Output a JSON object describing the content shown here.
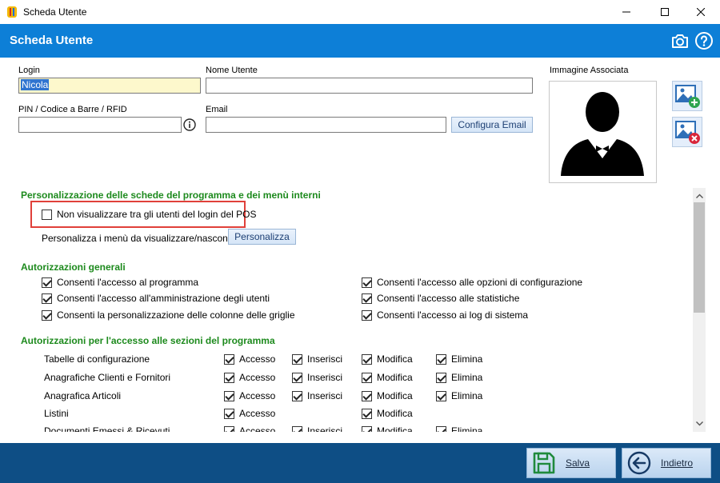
{
  "window": {
    "title": "Scheda Utente"
  },
  "header": {
    "title": "Scheda Utente"
  },
  "form": {
    "login_label": "Login",
    "login_value": "Nicola",
    "username_label": "Nome Utente",
    "username_value": "",
    "pin_label": "PIN / Codice a Barre / RFID",
    "pin_value": "",
    "email_label": "Email",
    "email_value": "",
    "config_email_button": "Configura Email",
    "image_label": "Immagine Associata"
  },
  "customization": {
    "section_title": "Personalizzazione delle schede del programma e dei menù interni",
    "hide_pos_login_label": "Non visualizzare tra gli utenti del login del POS",
    "hide_pos_login_checked": false,
    "menu_label": "Personalizza i menù da visualizzare/nascondere",
    "menu_button": "Personalizza"
  },
  "general": {
    "section_title": "Autorizzazioni generali",
    "items": [
      {
        "label": "Consenti l'accesso al programma",
        "checked": true
      },
      {
        "label": "Consenti l'accesso all'amministrazione degli utenti",
        "checked": true
      },
      {
        "label": "Consenti la personalizzazione delle colonne delle griglie",
        "checked": true
      },
      {
        "label": "Consenti l'accesso alle opzioni di configurazione",
        "checked": true
      },
      {
        "label": "Consenti l'accesso alle statistiche",
        "checked": true
      },
      {
        "label": "Consenti l'accesso ai log di sistema",
        "checked": true
      }
    ]
  },
  "sections": {
    "section_title": "Autorizzazioni per l'accesso alle sezioni del programma",
    "perm_labels": {
      "access": "Accesso",
      "insert": "Inserisci",
      "modify": "Modifica",
      "delete": "Elimina"
    },
    "rows": [
      {
        "name": "Tabelle di configurazione",
        "access": true,
        "insert": true,
        "modify": true,
        "delete": true
      },
      {
        "name": "Anagrafiche Clienti e Fornitori",
        "access": true,
        "insert": true,
        "modify": true,
        "delete": true
      },
      {
        "name": "Anagrafica Articoli",
        "access": true,
        "insert": true,
        "modify": true,
        "delete": true
      },
      {
        "name": "Listini",
        "access": true,
        "insert": null,
        "modify": true,
        "delete": null
      },
      {
        "name": "Documenti Emessi & Ricevuti",
        "access": true,
        "insert": true,
        "modify": true,
        "delete": true
      }
    ]
  },
  "footer": {
    "save_label": "Salva",
    "back_label": "Indietro"
  },
  "icons": {
    "app": "app-logo-icon",
    "camera": "camera-icon",
    "help": "help-icon",
    "info": "info-icon",
    "avatar": "user-avatar-icon",
    "add_image": "add-image-icon",
    "remove_image": "remove-image-icon",
    "save": "save-icon",
    "back": "back-arrow-icon"
  },
  "colors": {
    "header": "#0d7fd7",
    "footer": "#0e4e85",
    "section_title": "#1d8a1d",
    "highlight": "#e0403a"
  }
}
